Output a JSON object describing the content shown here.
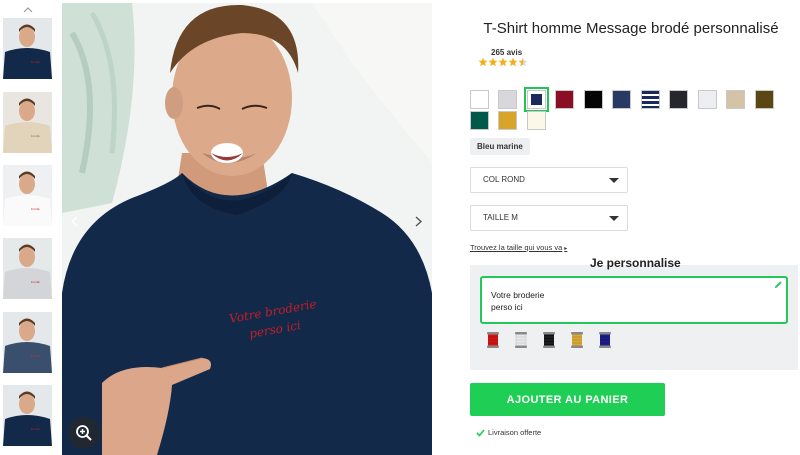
{
  "product": {
    "title": "T-Shirt homme Message brodé personnalisé",
    "reviews_count": "265 avis",
    "rating": 4.5,
    "rating_max": 5
  },
  "gallery": {
    "thumbnails": [
      "navy",
      "beige",
      "white",
      "heather-grey",
      "navy-heather",
      "navy"
    ],
    "main_embroidery_text": "Votre broderie perso ici"
  },
  "colors": {
    "swatches": [
      {
        "hex": "#ffffff",
        "selected": false
      },
      {
        "hex": "#d8d8dc",
        "selected": false
      },
      {
        "hex": "#1b2a5c",
        "selected": true
      },
      {
        "hex": "#8b0f24",
        "selected": false
      },
      {
        "hex": "#050505",
        "selected": false
      },
      {
        "hex": "#283a64",
        "selected": false
      },
      {
        "hex": "stripes",
        "selected": false
      },
      {
        "hex": "#25272c",
        "selected": false
      },
      {
        "hex": "#eceef2",
        "selected": false
      },
      {
        "hex": "#d5c3a8",
        "selected": false
      },
      {
        "hex": "#5a4714",
        "selected": false
      },
      {
        "hex": "#00594b",
        "selected": false
      },
      {
        "hex": "#d9a42a",
        "selected": false
      },
      {
        "hex": "#fbf8e9",
        "selected": false
      }
    ],
    "selected_name": "Bleu marine"
  },
  "options": {
    "collar": "COL ROND",
    "size": "TAILLE M",
    "size_link": "Trouvez la taille qui vous va"
  },
  "personalize": {
    "title": "Je personnalise",
    "text": "Votre broderie\nperso ici",
    "thread_colors": [
      "#d01616",
      "#e8e8e8",
      "#111111",
      "#d9aa3a",
      "#1c1e8a"
    ]
  },
  "cart": {
    "button_label": "AJOUTER AU PANIER",
    "delivery_text": "Livraison offerte"
  },
  "theme": {
    "accent_green": "#1fce54"
  }
}
